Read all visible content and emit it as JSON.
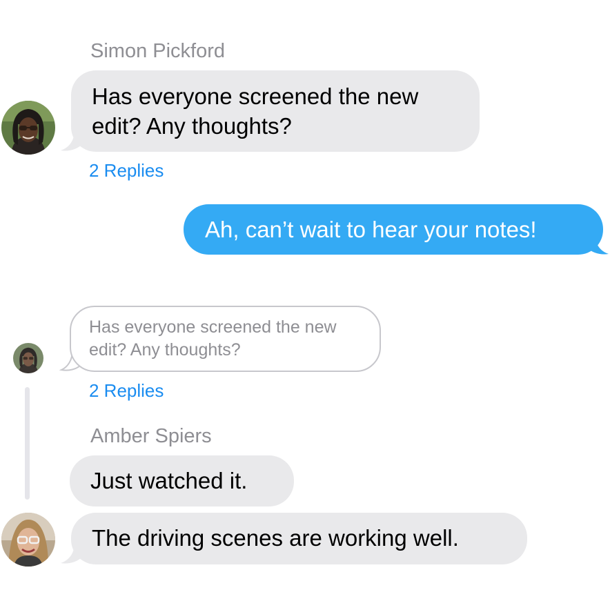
{
  "message_1": {
    "sender": "Simon Pickford",
    "lines": [
      "Has everyone screened the new",
      "edit? Any thoughts?"
    ],
    "replies_label": "2 Replies"
  },
  "outgoing": {
    "text": "Ah, can’t wait to hear your notes!"
  },
  "quoted": {
    "lines": [
      "Has everyone screened the new",
      "edit? Any thoughts?"
    ],
    "replies_label": "2 Replies"
  },
  "reply_1": {
    "sender": "Amber Spiers",
    "text": "Just watched it."
  },
  "reply_2": {
    "text": "The driving scenes are working well."
  },
  "colors": {
    "incoming_bubble": "#e9e9eb",
    "outgoing_bubble": "#34aaf4",
    "link": "#1a8cf0",
    "sender_name": "#8e8e93",
    "quoted_border": "#c7c7cc",
    "thread_line": "#e5e5ea"
  },
  "icons": [
    "avatar-simon-pickford",
    "avatar-amber-spiers"
  ]
}
